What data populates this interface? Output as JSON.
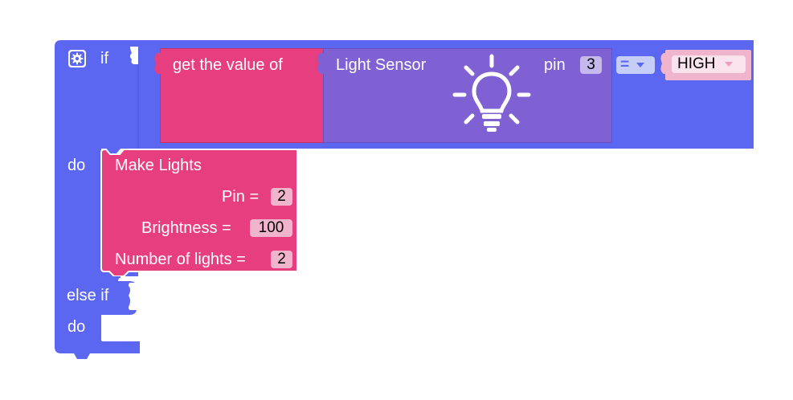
{
  "if_block": {
    "if_label": "if",
    "do_label": "do",
    "else_if_label": "else if",
    "do2_label": "do",
    "gear_icon": "gear-icon"
  },
  "get_value_block": {
    "label": "get the value of"
  },
  "sensor_block": {
    "label": "Light Sensor",
    "icon": "lightbulb-icon",
    "pin_label": "pin",
    "pin_value": "3"
  },
  "compare": {
    "operator": "="
  },
  "high_block": {
    "value": "HIGH"
  },
  "make_lights_block": {
    "title": "Make Lights",
    "pin_label": "Pin =",
    "pin_value": "2",
    "brightness_label": "Brightness =",
    "brightness_value": "100",
    "lights_label": "Number of lights =",
    "lights_value": "2"
  },
  "colors": {
    "control_blue": "#5b67f0",
    "get_value_pink": "#e63e7e",
    "sensor_purple": "#7f61d3",
    "high_pink": "#f1b4cd"
  }
}
